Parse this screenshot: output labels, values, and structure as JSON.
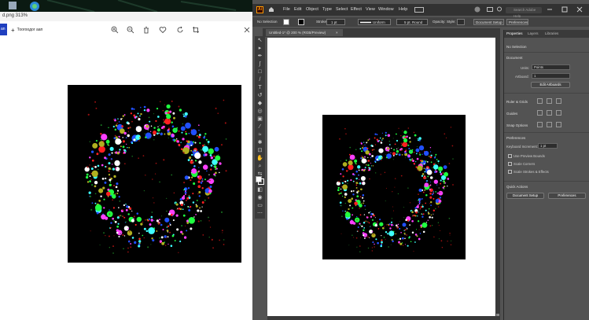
{
  "viewer": {
    "title": "d.png   313%",
    "edit_label": "an",
    "create_label": "Тоогоодог аап",
    "toolbar_icons": [
      "zoom-in-icon",
      "zoom-out-icon",
      "delete-icon",
      "favorite-icon",
      "rotate-icon",
      "crop-icon"
    ]
  },
  "illustrator": {
    "menu": [
      "File",
      "Edit",
      "Object",
      "Type",
      "Select",
      "Effect",
      "View",
      "Window",
      "Help"
    ],
    "search_placeholder": "Search Adobe Help",
    "control_bar": {
      "selection": "No Selection",
      "stroke_label": "Stroke:",
      "stroke_value": "1 pt",
      "uniform": "Uniform",
      "brush": "5 pt. Round",
      "opacity_label": "Opacity:",
      "style_label": "Style:",
      "document_setup": "Document Setup",
      "preferences": "Preferences"
    },
    "document_tab": "Untitled-1* @ 200 % (RGB/Preview)",
    "document_tab_close": "×",
    "properties": {
      "tabs": [
        "Properties",
        "Layers",
        "Libraries"
      ],
      "no_selection": "No Selection",
      "document": "Document",
      "units_label": "Units:",
      "units_value": "Points",
      "artboard_label": "Artboard:",
      "artboard_value": "1",
      "edit_artboards": "Edit Artboards",
      "ruler_grids": "Ruler & Grids",
      "guides": "Guides",
      "snap_options": "Snap Options",
      "preferences_section": "Preferences",
      "keyboard_increment_label": "Keyboard Increment:",
      "keyboard_increment_value": "1 pt",
      "use_preview_bounds": "Use Preview Bounds",
      "scale_corners": "Scale Corners",
      "scale_strokes": "Scale Strokes & Effects",
      "quick_actions": "Quick Actions",
      "document_setup_btn": "Document Setup",
      "preferences_btn": "Preferences"
    }
  }
}
